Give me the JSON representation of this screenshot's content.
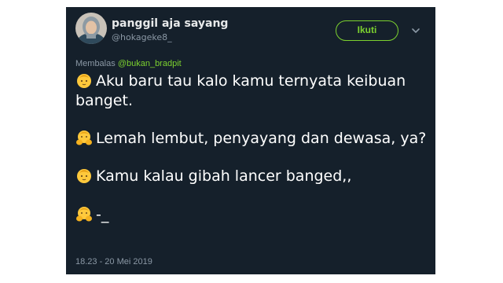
{
  "author": {
    "display_name": "panggil aja sayang",
    "handle": "@hokageke8_"
  },
  "follow_button": {
    "label": "Ikuti"
  },
  "reply": {
    "prefix": "Membalas",
    "mention": "@bukan_bradpit"
  },
  "tweet": {
    "paragraphs": [
      {
        "emoji": "baby",
        "text": "Aku baru tau kalo kamu ternyata keibuan banget."
      },
      {
        "emoji": "baby-with-hands-on-face",
        "text": "Lemah lembut, penyayang dan dewasa, ya?"
      },
      {
        "emoji": "baby",
        "text": "Kamu kalau gibah lancer banged,,"
      },
      {
        "emoji": "baby-with-hands-on-face",
        "text": "-_"
      }
    ],
    "timestamp": "18.23 - 20 Mei 2019"
  },
  "colors": {
    "background": "#15202b",
    "accent": "#7cd12f",
    "text": "#ffffff",
    "muted": "#8b98a5"
  }
}
